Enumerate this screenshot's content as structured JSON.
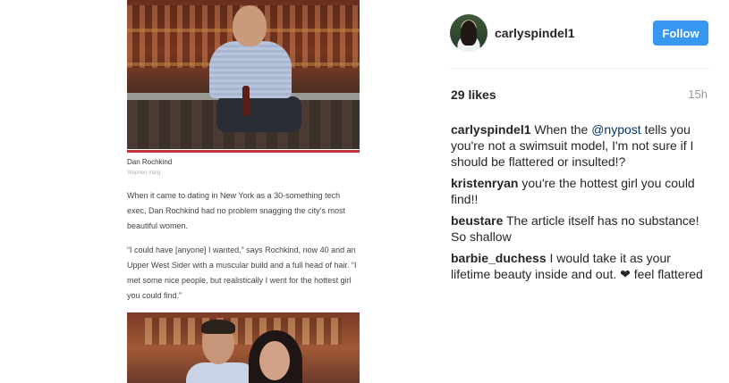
{
  "article": {
    "caption_name": "Dan Rochkind",
    "caption_credit": "Stephen Yang",
    "paragraphs": [
      "When it came to dating in New York as a 30-something tech exec, Dan Rochkind had no problem snagging the city’s most beautiful women.",
      "“I could have [anyone] I wanted,” says Rochkind, now 40 and an Upper West Sider with a muscular build and a full head of hair. “I met some nice people, but realistically I went for the hottest girl you could find.”"
    ]
  },
  "post": {
    "username": "carlyspindel1",
    "follow_label": "Follow",
    "likes": "29 likes",
    "time": "15h",
    "caption": {
      "user": "carlyspindel1",
      "before": "When the",
      "mention": "@nypost",
      "after": "tells you you're not a swimsuit model, I'm not sure if I should be flattered or insulted!?"
    },
    "comments": [
      {
        "user": "kristenryan",
        "text": "you're the hottest girl you could find!!"
      },
      {
        "user": "beustare",
        "text": "The article itself has no substance! So shallow"
      },
      {
        "user": "barbie_duchess",
        "text": "I would take it as your lifetime beauty inside and out.",
        "emoji": "❤",
        "text_after": "feel flattered"
      }
    ]
  },
  "colors": {
    "follow_button": "#3897f0",
    "mention": "#003569",
    "article_rule": "#c0323a"
  }
}
